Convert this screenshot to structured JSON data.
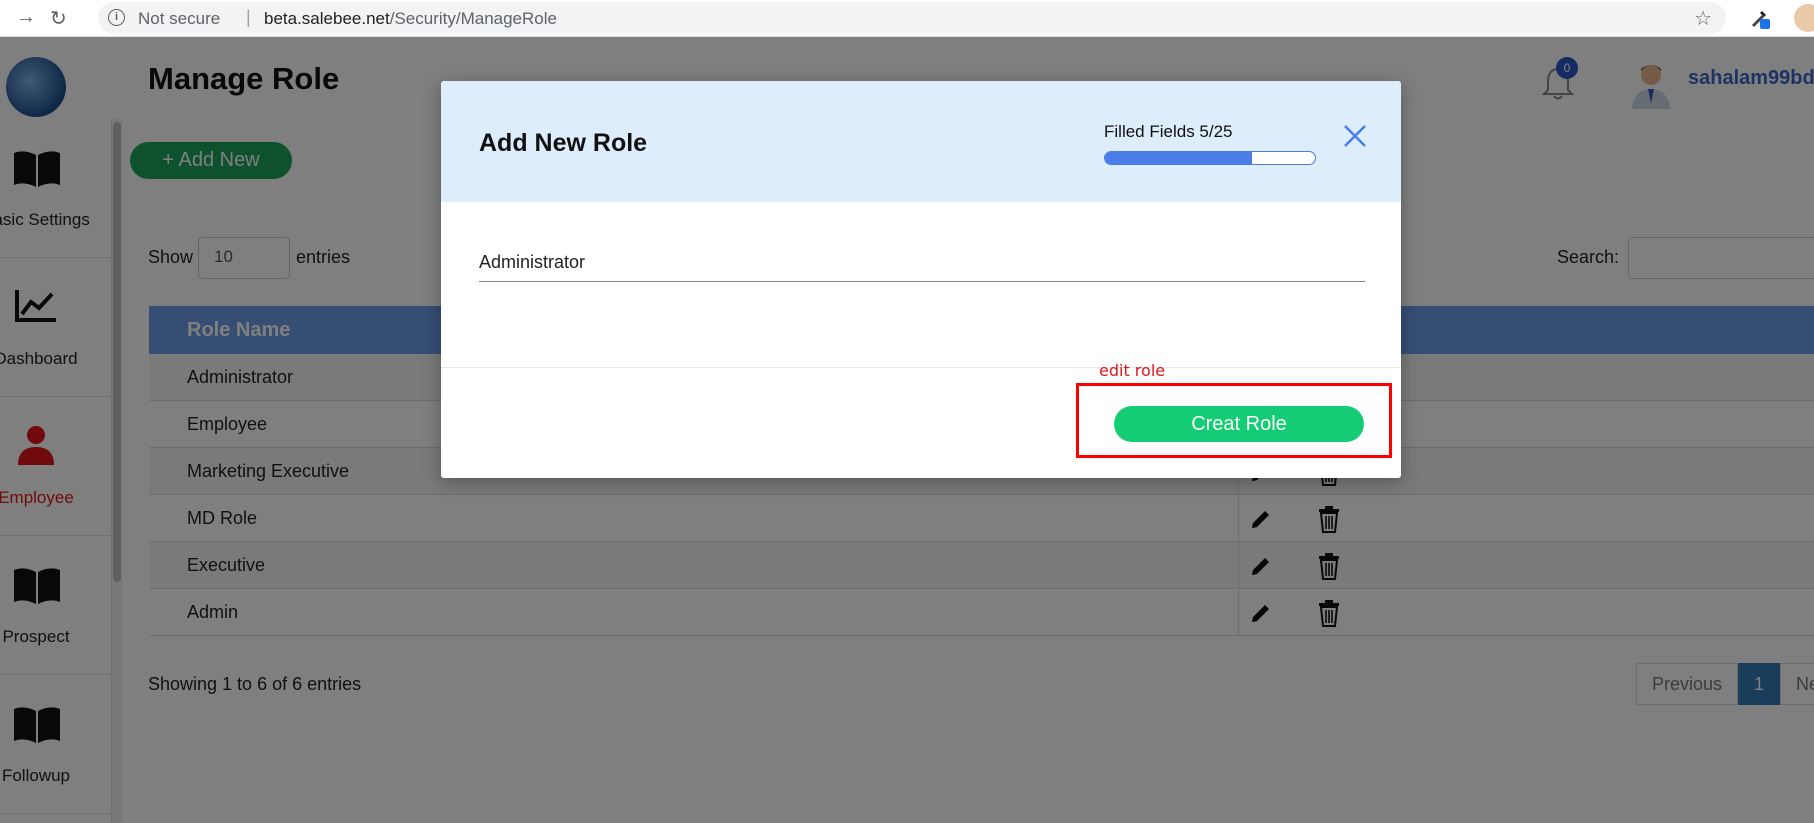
{
  "browser": {
    "security_label": "Not secure",
    "url_host": "beta.salebee.net",
    "url_path": "/Security/ManageRole"
  },
  "header": {
    "page_title": "Manage Role",
    "notification_count": "0",
    "username": "sahalam99bd"
  },
  "sidebar": {
    "items": [
      {
        "label": "Basic Settings",
        "icon": "book-icon"
      },
      {
        "label": "Dashboard",
        "icon": "chart-line-icon"
      },
      {
        "label": "Employee",
        "icon": "user-icon",
        "active": true
      },
      {
        "label": "Prospect",
        "icon": "book-icon"
      },
      {
        "label": "Followup",
        "icon": "book-icon"
      }
    ]
  },
  "toolbar": {
    "add_new_label": "+ Add New",
    "show_label": "Show",
    "entries_value": "10",
    "entries_label": "entries",
    "search_label": "Search:"
  },
  "table": {
    "header": "Role Name",
    "rows": [
      "Administrator",
      "Employee",
      "Marketing Executive",
      "MD Role",
      "Executive",
      "Admin"
    ]
  },
  "footer": {
    "showing": "Showing 1 to 6 of 6 entries",
    "previous": "Previous",
    "page": "1",
    "next": "Ne"
  },
  "modal": {
    "title": "Add New Role",
    "filled_label": "Filled Fields 5/25",
    "progress_fraction": 0.7,
    "role_name_value": "Administrator",
    "annotation": "edit role",
    "submit_label": "Creat Role"
  },
  "colors": {
    "accent_blue": "#4a7de6",
    "submit_green": "#13cc73",
    "add_green": "#1aa55a",
    "annotation_red": "#ff0000"
  }
}
